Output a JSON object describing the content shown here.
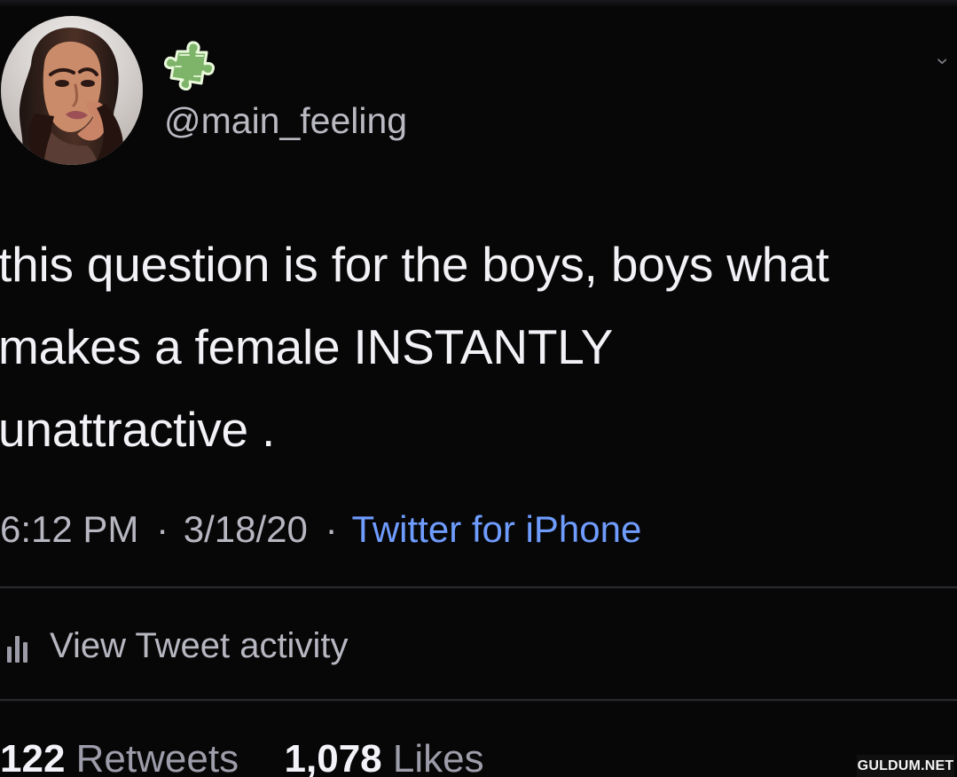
{
  "account": {
    "handle": "@main_feeling",
    "avatar_icon": "profile-photo",
    "badge_icon": "puzzle-piece-icon"
  },
  "tweet": {
    "lines": [
      "this question is for the boys, boys what",
      "makes a female INSTANTLY",
      "unattractive ."
    ],
    "time": "6:12 PM",
    "separator": "·",
    "date": "3/18/20",
    "source": "Twitter for iPhone"
  },
  "activity": {
    "icon": "bar-chart-icon",
    "label": "View Tweet activity"
  },
  "stats": {
    "retweets_count": "122",
    "retweets_label": "Retweets",
    "likes_count": "1,078",
    "likes_label": "Likes"
  },
  "watermark": {
    "text": "GULDUM.NET"
  },
  "colors": {
    "background": "#070707",
    "primary_text": "#f1f1f6",
    "secondary_text": "#b7b7c2",
    "link": "#6f9cff",
    "divider": "#29292d"
  }
}
